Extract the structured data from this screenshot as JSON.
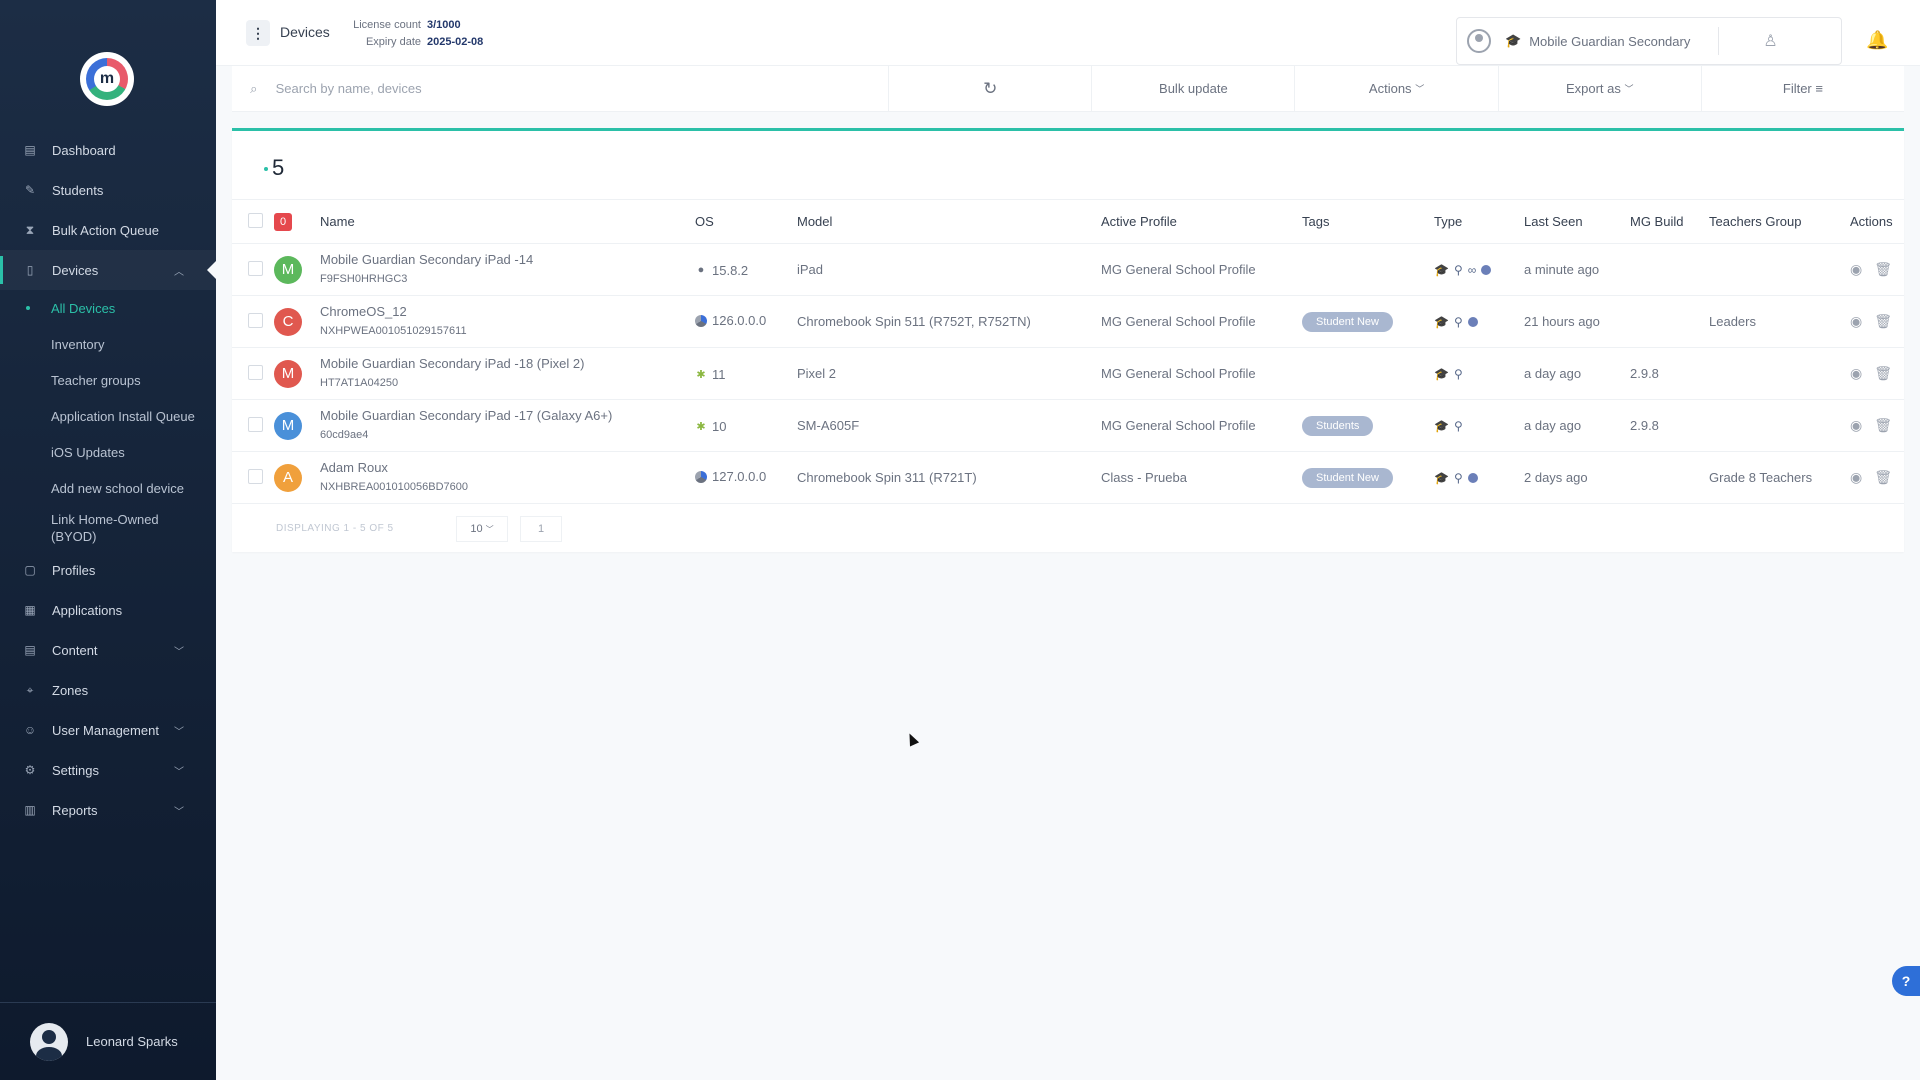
{
  "sidebar": {
    "items": [
      {
        "label": "Dashboard",
        "icon": "dashboard-icon"
      },
      {
        "label": "Students",
        "icon": "students-icon"
      },
      {
        "label": "Bulk Action Queue",
        "icon": "hourglass-icon"
      },
      {
        "label": "Devices",
        "icon": "devices-icon"
      }
    ],
    "devices_sub": [
      "All Devices",
      "Inventory",
      "Teacher groups",
      "Application Install Queue",
      "iOS Updates",
      "Add new school device",
      "Link Home-Owned (BYOD)"
    ],
    "items_after": [
      {
        "label": "Profiles"
      },
      {
        "label": "Applications"
      },
      {
        "label": "Content"
      },
      {
        "label": "Zones"
      },
      {
        "label": "User Management"
      },
      {
        "label": "Settings"
      },
      {
        "label": "Reports"
      }
    ],
    "user_name": "Leonard Sparks"
  },
  "header": {
    "page": "Devices",
    "license_label": "License count",
    "license_value": "3/1000",
    "expiry_label": "Expiry date",
    "expiry_value": "2025-02-08",
    "school_name": "Mobile Guardian Secondary"
  },
  "toolbar": {
    "search_placeholder": "Search by name, devices",
    "bulk_update": "Bulk update",
    "actions": "Actions",
    "export_as": "Export as",
    "filter": "Filter"
  },
  "table": {
    "count": "5",
    "selected_count": "0",
    "columns": [
      "Name",
      "OS",
      "Model",
      "Active Profile",
      "Tags",
      "Type",
      "Last Seen",
      "MG Build",
      "Teachers Group",
      "Actions"
    ],
    "rows": [
      {
        "initial": "M",
        "color": "#5cb85c",
        "name": "Mobile Guardian Secondary iPad -14",
        "serial": "F9FSH0HRHGC3",
        "os_icon": "apple",
        "os": "15.8.2",
        "model": "iPad",
        "profile": "MG General School Profile",
        "tag": "",
        "last_seen": "a minute ago",
        "build": "",
        "group": "",
        "type_extra": true
      },
      {
        "initial": "C",
        "color": "#e0584f",
        "name": "ChromeOS_12",
        "serial": "NXHPWEA001051029157611",
        "os_icon": "chrome",
        "os": "126.0.0.0",
        "model": "Chromebook Spin 511 (R752T, R752TN)",
        "profile": "MG General School Profile",
        "tag": "Student New",
        "last_seen": "21 hours ago",
        "build": "",
        "group": "Leaders",
        "type_extra": false
      },
      {
        "initial": "M",
        "color": "#e0584f",
        "name": "Mobile Guardian Secondary iPad -18 (Pixel 2)",
        "serial": "HT7AT1A04250",
        "os_icon": "android",
        "os": "11",
        "model": "Pixel 2",
        "profile": "MG General School Profile",
        "tag": "",
        "last_seen": "a day ago",
        "build": "2.9.8",
        "group": "",
        "type_extra": false
      },
      {
        "initial": "M",
        "color": "#4a90d9",
        "name": "Mobile Guardian Secondary iPad -17 (Galaxy A6+)",
        "serial": "60cd9ae4",
        "os_icon": "android",
        "os": "10",
        "model": "SM-A605F",
        "profile": "MG General School Profile",
        "tag": "Students",
        "last_seen": "a day ago",
        "build": "2.9.8",
        "group": "",
        "type_extra": false
      },
      {
        "initial": "A",
        "color": "#f0a03c",
        "name": "Adam Roux",
        "serial": "NXHBREA001010056BD7600",
        "os_icon": "chrome",
        "os": "127.0.0.0",
        "model": "Chromebook Spin 311 (R721T)",
        "profile": "Class - Prueba",
        "tag": "Student New",
        "last_seen": "2 days ago",
        "build": "",
        "group": "Grade 8 Teachers",
        "type_extra": false
      }
    ],
    "pagination": "DISPLAYING 1 - 5 OF 5",
    "page_size": "10",
    "page": "1"
  },
  "colors": {
    "accent": "#2bc0a8",
    "sidebar_bg": "#1c2d45",
    "tag_bg": "#a9b7d0",
    "danger": "#e5484d"
  }
}
